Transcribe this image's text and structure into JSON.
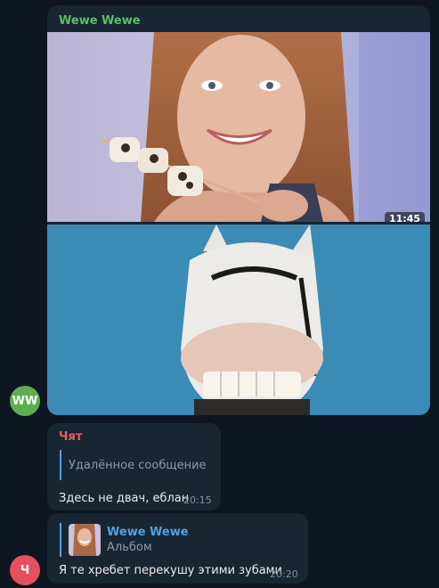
{
  "colors": {
    "background": "#0e1621",
    "bubble": "#182533",
    "sender_green": "#5fbd68",
    "sender_red": "#e85d5d",
    "link_blue": "#4fa3e0"
  },
  "album_message": {
    "sender": "Wewe Wewe",
    "video_duration": "11:45",
    "avatar_initials": "WW"
  },
  "message2": {
    "sender": "Чят",
    "reply_text": "Удалённое сообщение",
    "text": "Здесь не двач, еблан",
    "time": "20:15"
  },
  "message3": {
    "reply_sender": "Wewe Wewe",
    "reply_text": "Альбом",
    "text": "Я те хребет перекушу этими зубами",
    "time": "20:20",
    "avatar_initials": "Ч"
  }
}
